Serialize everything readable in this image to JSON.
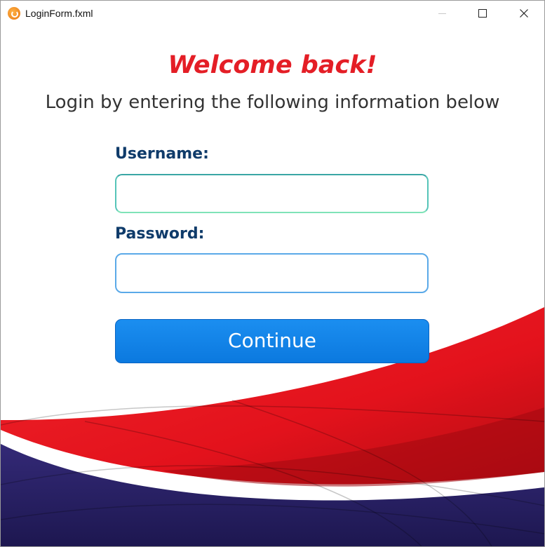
{
  "window": {
    "title": "LoginForm.fxml",
    "icon": "app-icon",
    "controls": [
      "minimize-icon",
      "maximize-icon",
      "close-icon"
    ]
  },
  "header": {
    "welcome": "Welcome back!",
    "subtitle": "Login by entering the following information below"
  },
  "form": {
    "username_label": "Username:",
    "username_value": "",
    "password_label": "Password:",
    "password_value": "",
    "continue_label": "Continue"
  },
  "colors": {
    "welcome": "#e41e26",
    "label": "#0f3b6a",
    "button": "#1486ea",
    "wave_red": "#e3121c",
    "wave_navy": "#2b2262"
  }
}
